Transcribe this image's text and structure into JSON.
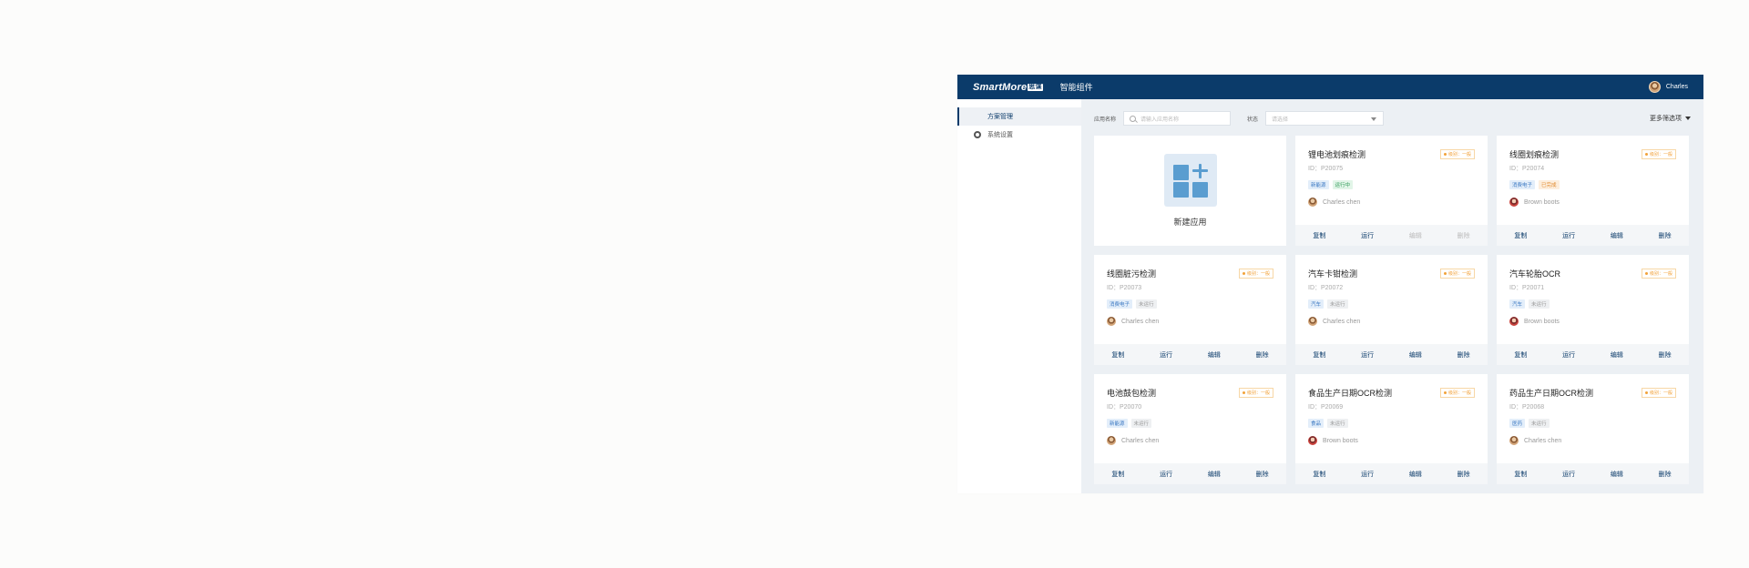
{
  "header": {
    "logo_text": "SmartMore",
    "logo_badge": "思谋",
    "nav_title": "智能组件",
    "user_name": "Charles"
  },
  "sidebar": {
    "items": [
      {
        "label": "方案管理",
        "active": true
      },
      {
        "label": "系统设置",
        "active": false
      }
    ]
  },
  "filters": {
    "app_name_label": "应用名称",
    "search_placeholder": "请输入应用名称",
    "status_label": "状态",
    "status_placeholder": "请选择",
    "more_filters": "更多筛选项"
  },
  "new_app": {
    "label": "新建应用"
  },
  "actions": {
    "copy": "复制",
    "run": "运行",
    "edit": "编辑",
    "delete": "删除"
  },
  "cards": [
    {
      "title": "锂电池划痕检测",
      "level": "级别：一般",
      "id": "ID：P20075",
      "tags": [
        {
          "text": "新能源",
          "color": "blue"
        },
        {
          "text": "运行中",
          "color": "green"
        }
      ],
      "owner": "Charles chen",
      "running": true
    },
    {
      "title": "线圈划痕检测",
      "level": "级别：一般",
      "id": "ID：P20074",
      "tags": [
        {
          "text": "消费电子",
          "color": "blue"
        },
        {
          "text": "已完成",
          "color": "orange"
        }
      ],
      "owner": "Brown boots",
      "running": false
    },
    {
      "title": "线圈脏污检测",
      "level": "级别：一般",
      "id": "ID：P20073",
      "tags": [
        {
          "text": "消费电子",
          "color": "blue"
        },
        {
          "text": "未运行",
          "color": "gray"
        }
      ],
      "owner": "Charles chen",
      "running": false
    },
    {
      "title": "汽车卡钳检测",
      "level": "级别：一般",
      "id": "ID：P20072",
      "tags": [
        {
          "text": "汽车",
          "color": "blue"
        },
        {
          "text": "未运行",
          "color": "gray"
        }
      ],
      "owner": "Charles chen",
      "running": false
    },
    {
      "title": "汽车轮胎OCR",
      "level": "级别：一般",
      "id": "ID：P20071",
      "tags": [
        {
          "text": "汽车",
          "color": "blue"
        },
        {
          "text": "未运行",
          "color": "gray"
        }
      ],
      "owner": "Brown boots",
      "running": false
    },
    {
      "title": "电池鼓包检测",
      "level": "级别：一般",
      "id": "ID：P20070",
      "tags": [
        {
          "text": "新能源",
          "color": "blue"
        },
        {
          "text": "未运行",
          "color": "gray"
        }
      ],
      "owner": "Charles chen",
      "running": false
    },
    {
      "title": "食品生产日期OCR检测",
      "level": "级别：一般",
      "id": "ID：P20069",
      "tags": [
        {
          "text": "食品",
          "color": "blue"
        },
        {
          "text": "未运行",
          "color": "gray"
        }
      ],
      "owner": "Brown boots",
      "running": false
    },
    {
      "title": "药品生产日期OCR检测",
      "level": "级别：一般",
      "id": "ID：P20068",
      "tags": [
        {
          "text": "医药",
          "color": "blue"
        },
        {
          "text": "未运行",
          "color": "gray"
        }
      ],
      "owner": "Charles chen",
      "running": false
    }
  ],
  "colors": {
    "brand": "#0b3b6a",
    "background": "#ecf0f4",
    "level": "#f2a23a"
  }
}
